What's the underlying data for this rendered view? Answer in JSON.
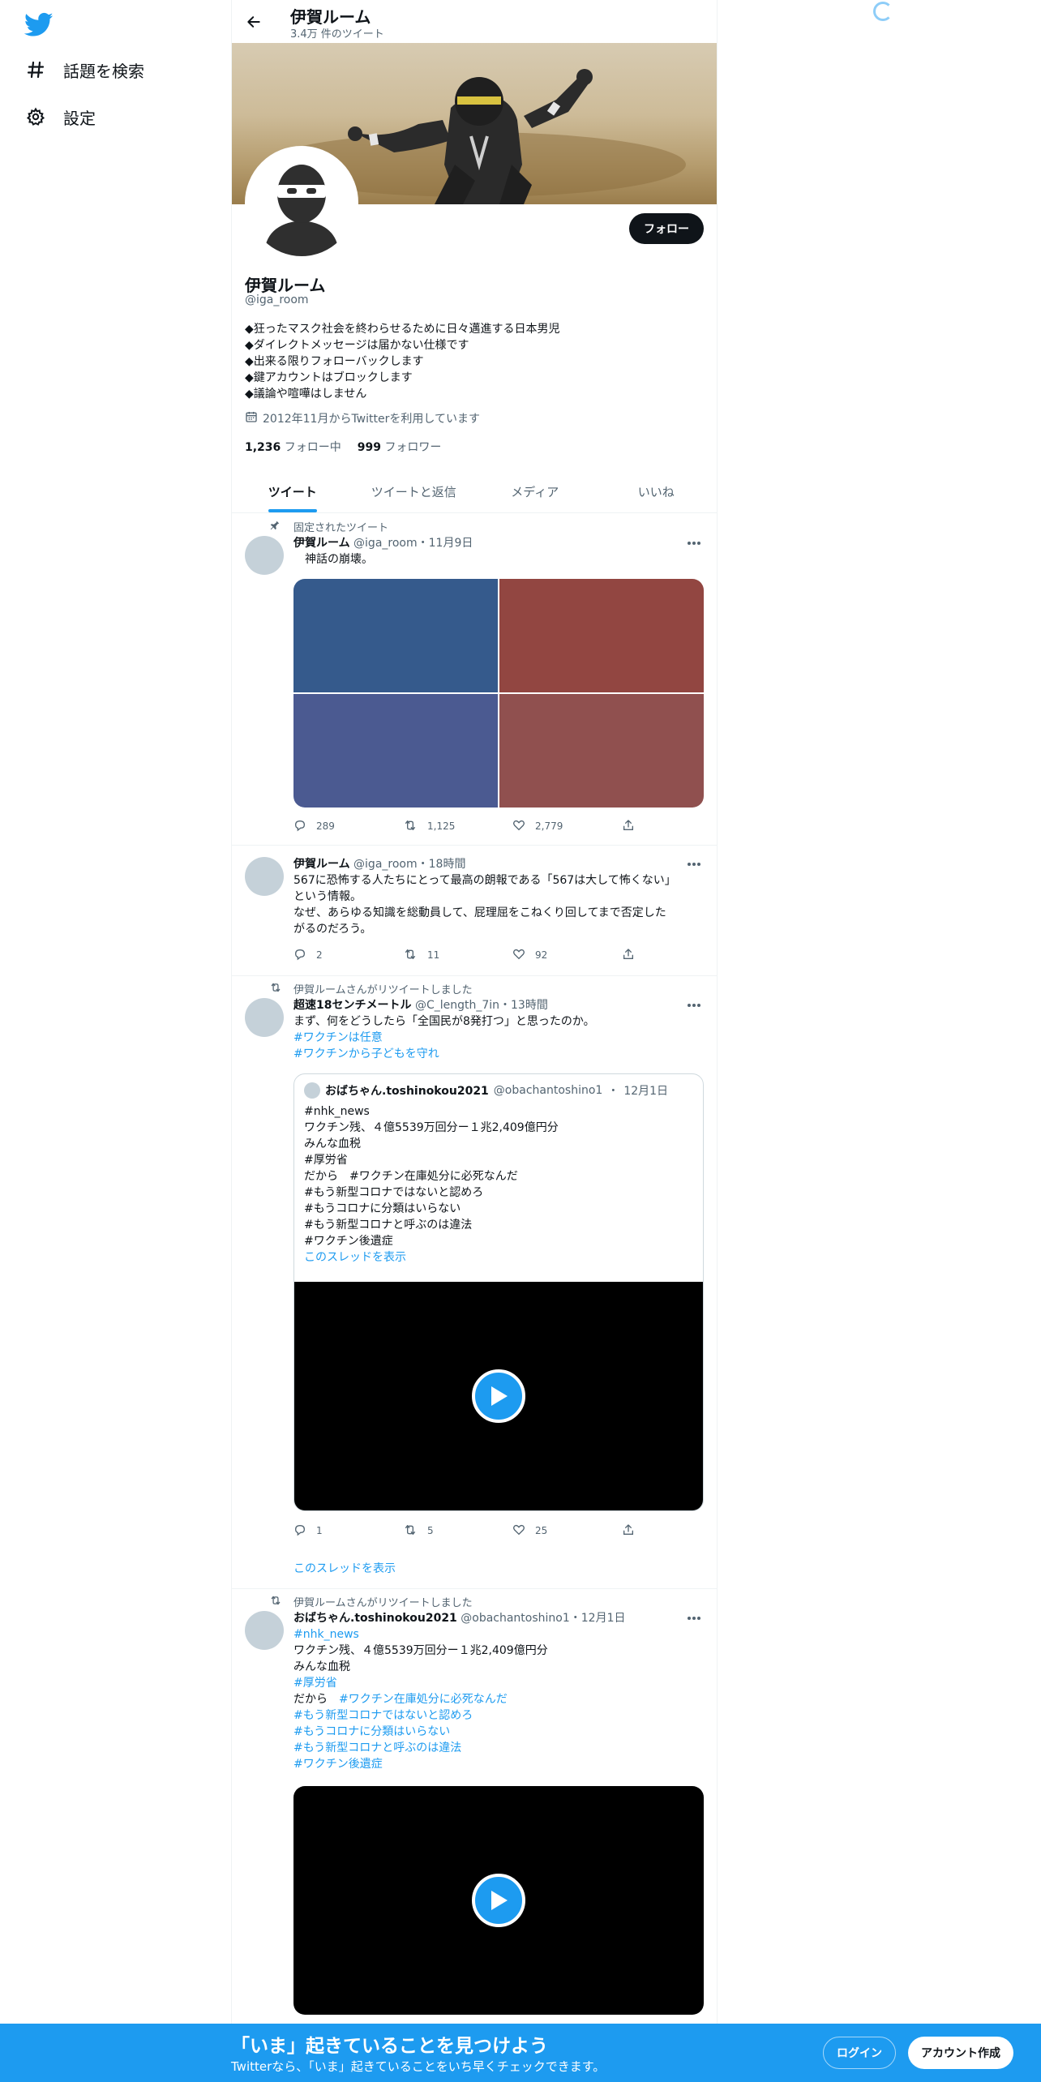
{
  "nav": {
    "explore_label": "話題を検索",
    "settings_label": "設定"
  },
  "header": {
    "name": "伊賀ルーム",
    "tweet_count": "3.4万 件のツイート"
  },
  "profile": {
    "name": "伊賀ルーム",
    "handle": "@iga_room",
    "follow_label": "フォロー",
    "bio": [
      "◆狂ったマスク社会を終わらせるために日々邁進する日本男児",
      "◆ダイレクトメッセージは届かない仕様です",
      "◆出来る限りフォローバックします",
      "◆鍵アカウントはブロックします",
      "◆議論や喧嘩はしません"
    ],
    "joined": "2012年11月からTwitterを利用しています",
    "following_count": "1,236",
    "following_label": "フォロー中",
    "followers_count": "999",
    "followers_label": "フォロワー"
  },
  "tabs": [
    {
      "label": "ツイート"
    },
    {
      "label": "ツイートと返信"
    },
    {
      "label": "メディア"
    },
    {
      "label": "いいね"
    }
  ],
  "tweets": [
    {
      "context": "固定されたツイート",
      "name": "伊賀ルーム",
      "handle": "@iga_room",
      "sep": "・",
      "time": "11月9日",
      "text": [
        "　神話の崩壊。"
      ],
      "media_colors": [
        "#355a8c",
        "#924641",
        "#4b5a91",
        "#90504f"
      ],
      "replies": "289",
      "retweets": "1,125",
      "likes": "2,779"
    },
    {
      "name": "伊賀ルーム",
      "handle": "@iga_room",
      "sep": "・",
      "time": "18時間",
      "text": [
        "567に恐怖する人たちにとって最高の朗報である「567は大して怖くない」",
        "という情報。",
        "なぜ、あらゆる知識を総動員して、屁理屈をこねくり回してまで否定した",
        "がるのだろう。"
      ],
      "replies": "2",
      "retweets": "11",
      "likes": "92"
    },
    {
      "context": "伊賀ルームさんがリツイートしました",
      "name": "超速18センチメートル",
      "handle": "@C_length_7in",
      "sep": "・",
      "time": "13時間",
      "text": [
        "まず、何をどうしたら「全国民が8発打つ」と思ったのか。"
      ],
      "hashtags": [
        "#ワクチンは任意",
        "#ワクチンから子どもを守れ"
      ],
      "quote": {
        "name": "おばちゃん.toshinokou2021",
        "handle": "@obachantoshino1",
        "sep": "・",
        "time": "12月1日",
        "lines": [
          "#nhk_news",
          "ワクチン残、４億5539万回分ー１兆2,409億円分",
          "みんな血税",
          "#厚労省",
          "だから　#ワクチン在庫処分に必死なんだ",
          "#もう新型コロナではないと認めろ",
          "#もうコロナに分類はいらない",
          "#もう新型コロナと呼ぶのは違法",
          "#ワクチン後遺症"
        ],
        "thread_label": "このスレッドを表示"
      },
      "replies": "1",
      "retweets": "5",
      "likes": "25",
      "thread_label": "このスレッドを表示"
    },
    {
      "context": "伊賀ルームさんがリツイートしました",
      "name": "おばちゃん.toshinokou2021",
      "handle": "@obachantoshino1",
      "sep": "・",
      "time": "12月1日",
      "text": [
        "#nhk_news",
        "ワクチン残、４億5539万回分ー１兆2,409億円分",
        "みんな血税",
        "#厚労省",
        "だから　#ワクチン在庫処分に必死なんだ",
        "#もう新型コロナではないと認めろ",
        "#もうコロナに分類はいらない",
        "#もう新型コロナと呼ぶのは違法",
        "#ワクチン後遺症"
      ]
    }
  ],
  "bottom_bar": {
    "title": "「いま」起きていることを見つけよう",
    "subtitle": "Twitterなら、「いま」起きていることをいち早くチェックできます。",
    "login_label": "ログイン",
    "signup_label": "アカウント作成"
  },
  "colors": {
    "accent": "#1d9bf0",
    "text": "#0f1419",
    "muted": "#536471"
  }
}
